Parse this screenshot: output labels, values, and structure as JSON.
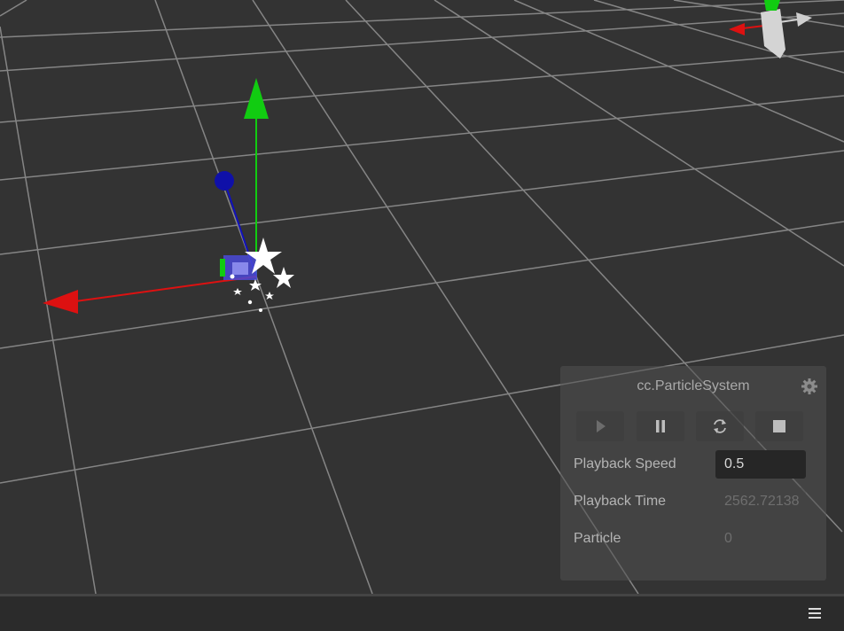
{
  "scene": {
    "grid_color": "#8a8a8a",
    "background_color": "#333333",
    "gizmo": {
      "x_axis_color": "#dd1111",
      "y_axis_color": "#11cc11",
      "z_axis_color": "#1111bb"
    },
    "orientation_widget": {
      "x_color": "#dd1111",
      "y_color": "#11cc11",
      "neg_x_color": "#cfcfcf"
    },
    "particle_icon": "star-particles-icon"
  },
  "particle_panel": {
    "title": "cc.ParticleSystem",
    "settings_icon": "gear-icon",
    "controls": [
      {
        "name": "play",
        "icon": "play-icon"
      },
      {
        "name": "pause",
        "icon": "pause-icon"
      },
      {
        "name": "restart",
        "icon": "restart-icon"
      },
      {
        "name": "stop",
        "icon": "stop-icon"
      }
    ],
    "properties": {
      "playback_speed": {
        "label": "Playback Speed",
        "value": "0.5"
      },
      "playback_time": {
        "label": "Playback Time",
        "value": "2562.72138"
      },
      "particle": {
        "label": "Particle",
        "value": "0"
      }
    }
  },
  "bottom_bar": {
    "menu_icon": "hamburger-menu-icon"
  }
}
